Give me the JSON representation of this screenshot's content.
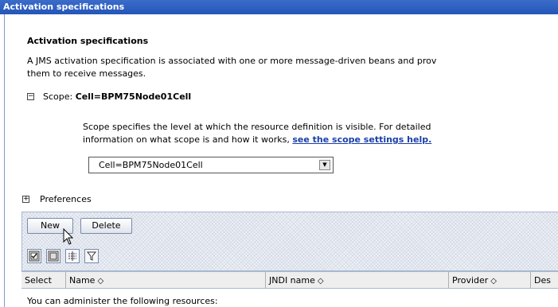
{
  "window": {
    "title": "Activation specifications"
  },
  "page": {
    "heading": "Activation specifications",
    "description_line1": "A JMS activation specification is associated with one or more message-driven beans and prov",
    "description_line2": "them to receive messages."
  },
  "scope": {
    "label": "Scope:",
    "value": "Cell=BPM75Node01Cell",
    "help_line1": "Scope specifies the level at which the resource definition is visible. For detailed",
    "help_line2": "information on what scope is and how it works,",
    "help_link": "see the scope settings help.",
    "selected": "Cell=BPM75Node01Cell",
    "expander_symbol": "−"
  },
  "preferences": {
    "label": "Preferences",
    "expander_symbol": "+"
  },
  "toolbar": {
    "new_label": "New",
    "delete_label": "Delete",
    "icons": [
      "select-all-icon",
      "deselect-all-icon",
      "show-filter-icon",
      "clear-filter-icon"
    ]
  },
  "table": {
    "columns": [
      "Select",
      "Name",
      "JNDI name",
      "Provider",
      "Des"
    ],
    "sort_glyph": "◇",
    "message": "You can administer the following resources:"
  },
  "colors": {
    "title_bar": "#2456b8",
    "link": "#1b3fa8",
    "panel": "#eef1f6"
  }
}
